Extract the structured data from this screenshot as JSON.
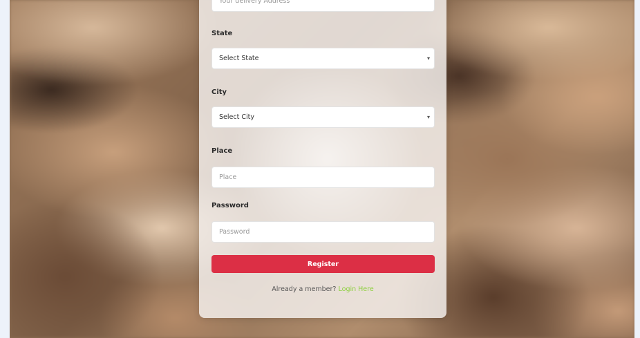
{
  "form": {
    "address_placeholder": "Your delivery Address",
    "state": {
      "label": "State",
      "selected": "Select State"
    },
    "city": {
      "label": "City",
      "selected": "Select City"
    },
    "place": {
      "label": "Place",
      "placeholder": "Place"
    },
    "password": {
      "label": "Password",
      "placeholder": "Password"
    },
    "register_label": "Register",
    "footer_text": "Already a member?",
    "login_link": "Login Here"
  },
  "icons": {
    "select_chevron": "chevron-down-icon"
  },
  "colors": {
    "register_button": "#dc2f45",
    "login_link": "#8ccf3c"
  }
}
